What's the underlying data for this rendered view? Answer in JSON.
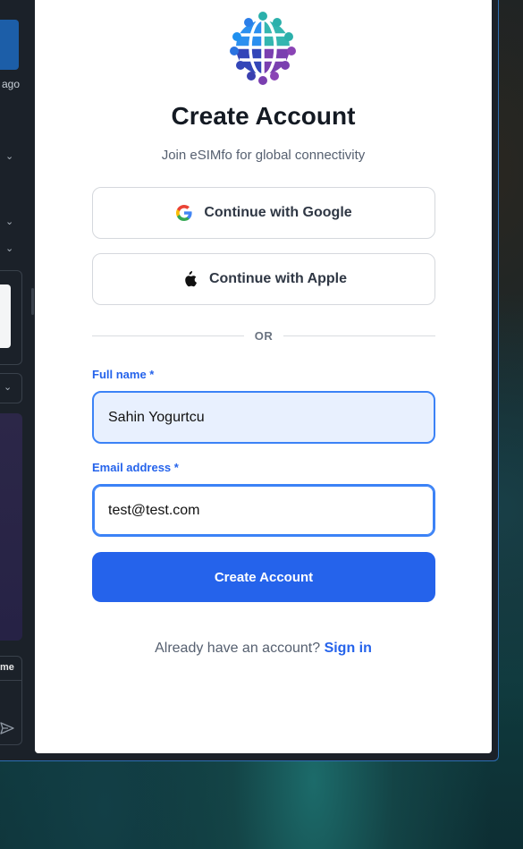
{
  "background_app": {
    "time_suffix": "ago",
    "me_label": "me"
  },
  "logo": {
    "icon": "globe-people-logo"
  },
  "title": "Create Account",
  "subtitle": "Join eSIMfo for global connectivity",
  "oauth": {
    "google_label": "Continue with Google",
    "apple_label": "Continue with Apple"
  },
  "divider_text": "OR",
  "form": {
    "full_name_label": "Full name *",
    "full_name_value": "Sahin Yogurtcu",
    "email_label": "Email address *",
    "email_value": "test@test.com",
    "submit_label": "Create Account"
  },
  "signin": {
    "prompt": "Already have an account?",
    "link": "Sign in"
  },
  "colors": {
    "accent": "#2563eb",
    "field_bg_autofill": "#e8f0fe",
    "title": "#141a23"
  }
}
